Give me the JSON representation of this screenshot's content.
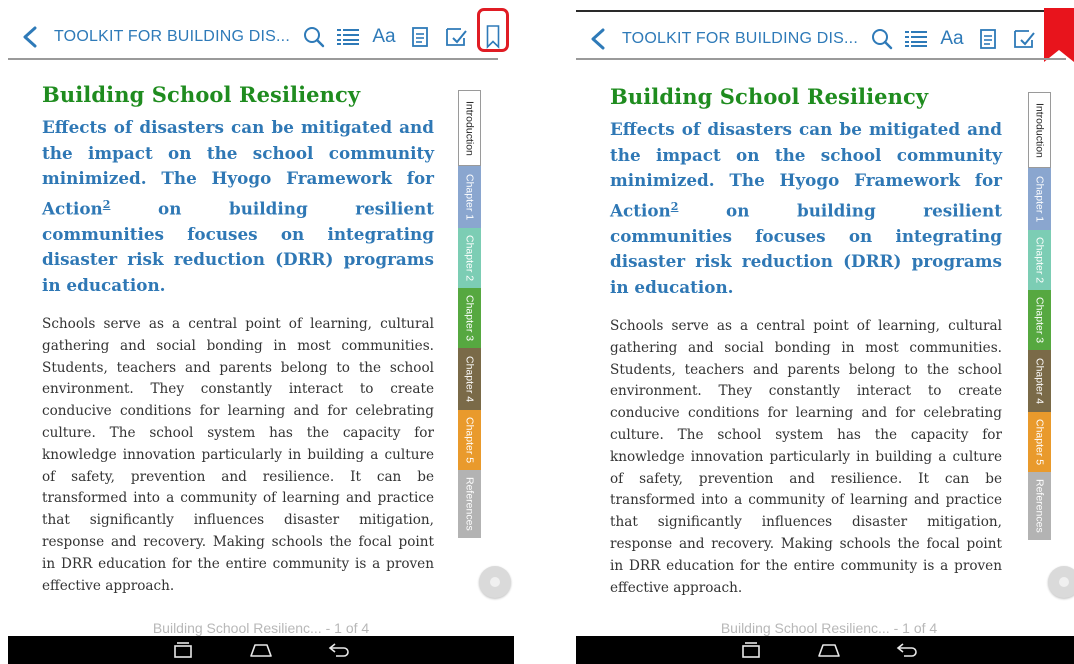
{
  "colors": {
    "accent": "#2e7ab8",
    "heading_green": "#1f8c1f",
    "bookmark_active": "#e8141c",
    "highlight_outline": "#e01c24"
  },
  "header": {
    "title": "TOOLKIT FOR BUILDING DIS...",
    "icons": [
      "back-arrow-icon",
      "search-icon",
      "table-of-contents-icon",
      "font-size-icon",
      "notes-icon",
      "annotate-icon",
      "bookmark-icon"
    ],
    "font_label": "Aa"
  },
  "article": {
    "title": "Building School Resiliency",
    "lead": "Effects of disasters can be mitigated and the impact on the school community minimized. The Hyogo Framework for Action",
    "footnote": "2",
    "lead_end": " on building resilient communities focuses on integrating disaster risk reduction (DRR) programs in education.",
    "body": "Schools serve as a central point of learning, cultural gathering and social bonding in most communities. Students, teachers and parents belong to the school environment. They constantly interact to create conducive conditions for learning and for celebrating culture. The school system has the capacity for knowledge innovation particularly in building a culture of safety, prevention and resilience. It can be transformed into a community of learning and practice that significantly influences disaster mitigation, response and recovery. Making schools the focal point in DRR education for the entire community is a proven effective approach."
  },
  "tabs": [
    {
      "label": "Introduction",
      "color": "#ffffff"
    },
    {
      "label": "Chapter 1",
      "color": "#8aa6cf"
    },
    {
      "label": "Chapter 2",
      "color": "#7ccdb4"
    },
    {
      "label": "Chapter 3",
      "color": "#56a840"
    },
    {
      "label": "Chapter 4",
      "color": "#7a6a48"
    },
    {
      "label": "Chapter 5",
      "color": "#e99a2c"
    },
    {
      "label": "References",
      "color": "#b3b3b3"
    }
  ],
  "footer": {
    "page_indicator": "Building School Resilienc... - 1 of 4"
  },
  "system_nav": {
    "icons": [
      "recent-apps-icon",
      "home-icon",
      "back-icon"
    ]
  },
  "screens": [
    {
      "bookmark_state": "unbookmarked",
      "bookmark_highlighted": true
    },
    {
      "bookmark_state": "bookmarked",
      "bookmark_highlighted": false
    }
  ]
}
